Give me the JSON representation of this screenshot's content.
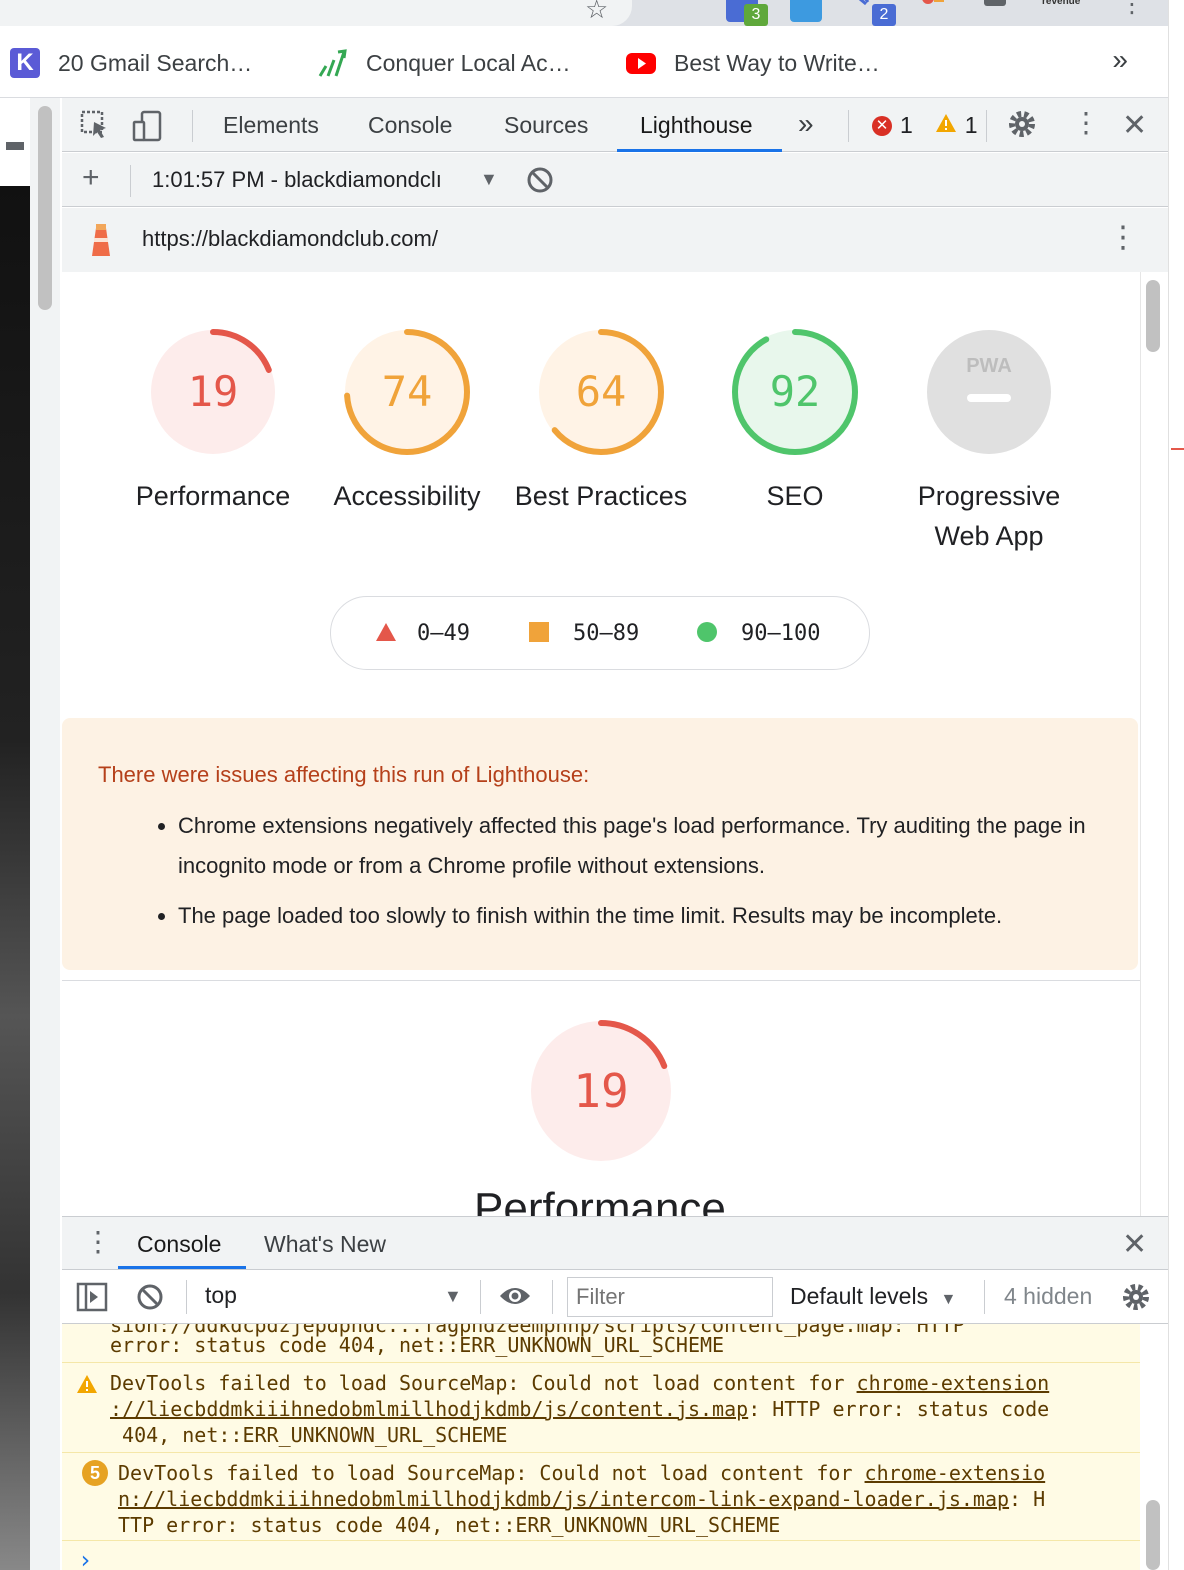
{
  "extensions": {
    "badge_a": "3",
    "badge_b": "2",
    "revenue_label": "revenue"
  },
  "bookmarks": [
    {
      "label": "20 Gmail Search…"
    },
    {
      "label": "Conquer Local Ac…"
    },
    {
      "label": "Best Way to Write…"
    }
  ],
  "bookmarks_more": "»",
  "devtools": {
    "tabs": [
      "Elements",
      "Console",
      "Sources",
      "Lighthouse"
    ],
    "more": "»",
    "error_count": "1",
    "warning_count": "1",
    "report_selector": "1:01:57 PM - blackdiamondclı",
    "url": "https://blackdiamondclub.com/"
  },
  "lighthouse": {
    "gauges": [
      {
        "name": "performance",
        "score": 19,
        "label": "Performance",
        "color": "#e4574a",
        "bg": "#fdeceb"
      },
      {
        "name": "accessibility",
        "score": 74,
        "label": "Accessibility",
        "color": "#f0a33a",
        "bg": "#fff3e6"
      },
      {
        "name": "best-practices",
        "score": 64,
        "label": "Best Practices",
        "color": "#f0a33a",
        "bg": "#fff3e6"
      },
      {
        "name": "seo",
        "score": 92,
        "label": "SEO",
        "color": "#4fc56b",
        "bg": "#e8f7ec"
      },
      {
        "name": "pwa",
        "score": null,
        "label": "Progressive Web App",
        "badge": "PWA",
        "color": "#bdbdbd",
        "bg": "#e0e0e0"
      }
    ],
    "legend": [
      {
        "range": "0–49",
        "color": "#e4574a",
        "shape": "triangle"
      },
      {
        "range": "50–89",
        "color": "#f0a33a",
        "shape": "square"
      },
      {
        "range": "90–100",
        "color": "#4fc56b",
        "shape": "circle"
      }
    ],
    "warnings": {
      "title": "There were issues affecting this run of Lighthouse:",
      "items": [
        "Chrome extensions negatively affected this page's load performance. Try auditing the page in incognito mode or from a Chrome profile without extensions.",
        "The page loaded too slowly to finish within the time limit. Results may be incomplete."
      ]
    },
    "section": {
      "score": 19,
      "heading": "Performance"
    }
  },
  "drawer": {
    "tabs": [
      "Console",
      "What's New"
    ],
    "context": "top",
    "filter_placeholder": "Filter",
    "levels": "Default levels",
    "hidden": "4 hidden"
  },
  "console": {
    "messages": [
      {
        "lines": [
          "error: status code 404, net::ERR_UNKNOWN_URL_SCHEME"
        ],
        "icon": "none",
        "partial_top": "sion://ddkdcpdzjepdphdc...fagphdzeemphhp/scripts/content_page.map: HTTP"
      },
      {
        "icon": "warning",
        "prefix": "DevTools failed to load SourceMap: Could not load content for ",
        "link": "chrome-extension://liecbddmkiiihnedobmlmillhodjkdmb/js/content.js.map",
        "suffix": ": HTTP error: status code 404, net::ERR_UNKNOWN_URL_SCHEME"
      },
      {
        "icon": "count",
        "count": "5",
        "prefix": "DevTools failed to load SourceMap: Could not load content for ",
        "link": "chrome-extension://liecbddmkiiihnedobmlmillhodjkdmb/js/intercom-link-expand-loader.js.map",
        "suffix": ": HTTP error: status code 404, net::ERR_UNKNOWN_URL_SCHEME"
      }
    ],
    "prompt": "›"
  }
}
